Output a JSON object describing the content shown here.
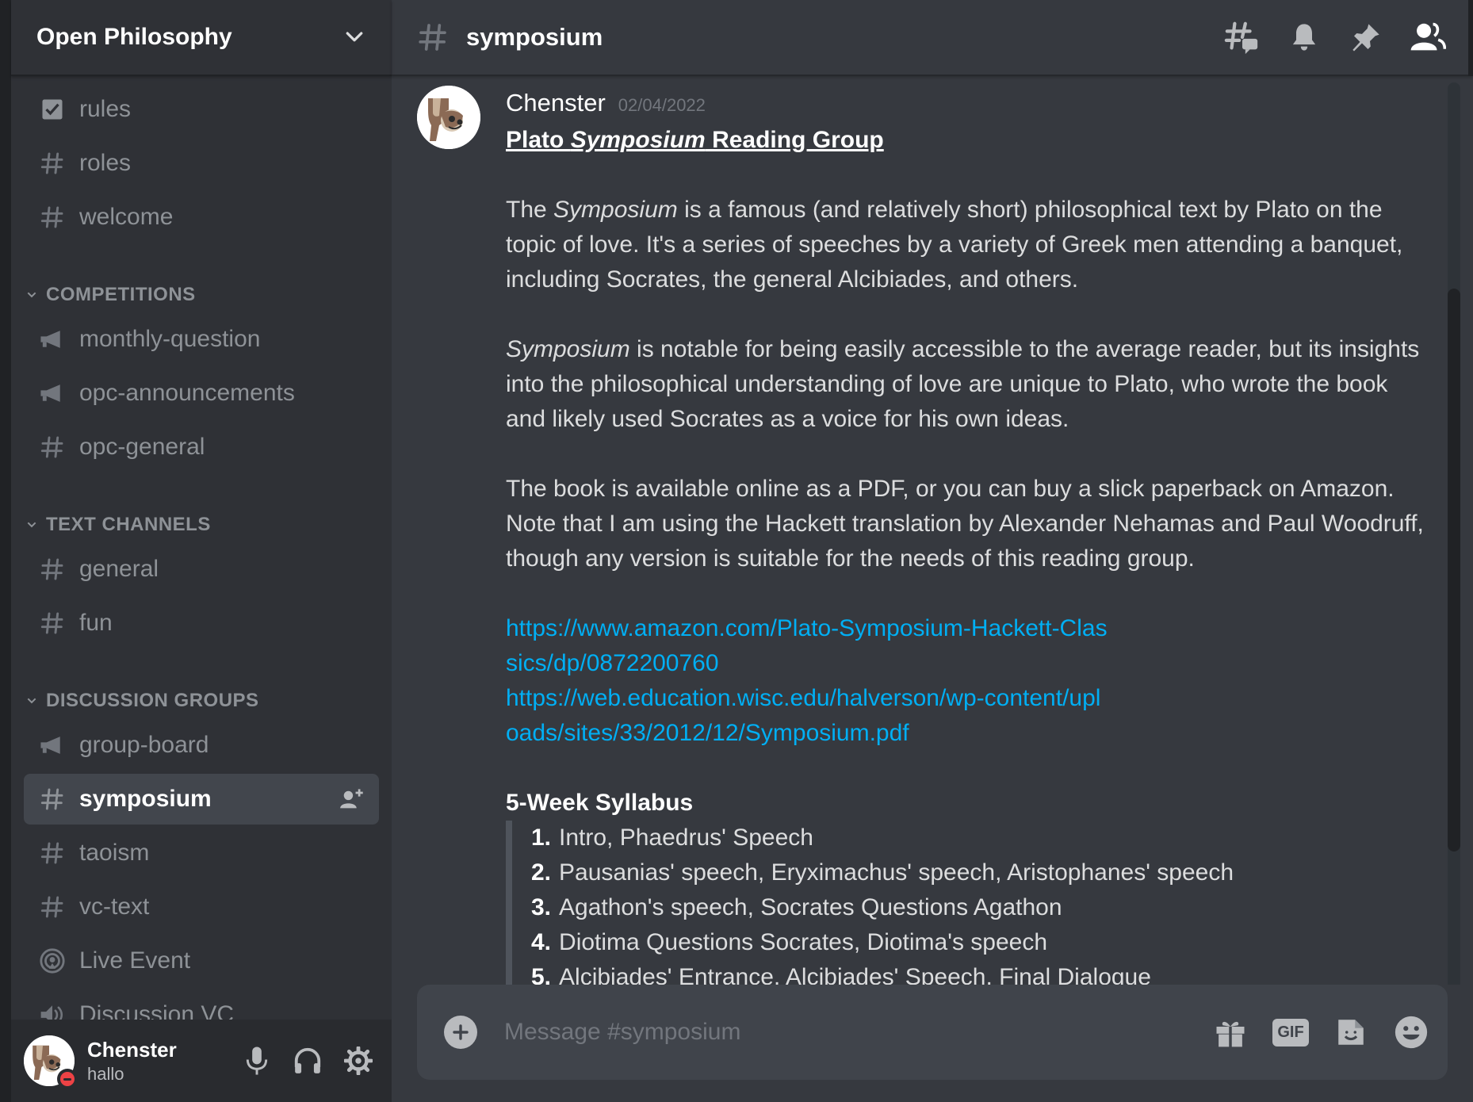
{
  "server": {
    "name": "Open Philosophy"
  },
  "channels_top": [
    {
      "name": "rules",
      "icon": "rules-checkbox-icon"
    },
    {
      "name": "roles",
      "icon": "hash-icon"
    },
    {
      "name": "welcome",
      "icon": "hash-icon"
    }
  ],
  "categories": [
    {
      "name": "COMPETITIONS",
      "channels": [
        {
          "name": "monthly-question",
          "icon": "announcement-icon"
        },
        {
          "name": "opc-announcements",
          "icon": "announcement-icon"
        },
        {
          "name": "opc-general",
          "icon": "hash-icon"
        }
      ]
    },
    {
      "name": "TEXT CHANNELS",
      "channels": [
        {
          "name": "general",
          "icon": "hash-icon"
        },
        {
          "name": "fun",
          "icon": "hash-icon"
        }
      ]
    },
    {
      "name": "DISCUSSION GROUPS",
      "channels": [
        {
          "name": "group-board",
          "icon": "announcement-icon"
        },
        {
          "name": "symposium",
          "icon": "hash-icon",
          "active": true
        },
        {
          "name": "taoism",
          "icon": "hash-icon"
        },
        {
          "name": "vc-text",
          "icon": "hash-icon"
        },
        {
          "name": "Live Event",
          "icon": "stage-icon"
        },
        {
          "name": "Discussion VC",
          "icon": "speaker-icon"
        }
      ]
    }
  ],
  "user": {
    "name": "Chenster",
    "status": "hallo",
    "presence_color": "#ed4245"
  },
  "header": {
    "channel": "symposium"
  },
  "message": {
    "author": "Chenster",
    "timestamp": "02/04/2022",
    "title_pre": "Plato ",
    "title_italic": "Symposium",
    "title_post": " Reading Group",
    "p1_pre": "The ",
    "p1_italic": "Symposium",
    "p1_post": " is a famous (and relatively short) philosophical text by Plato on the topic of love. It's a series of speeches by a variety of Greek men attending a banquet, including Socrates, the general Alcibiades, and others.",
    "p2_italic": "Symposium",
    "p2_post": " is notable for being easily accessible to the average reader, but its insights into the philosophical understanding of love are unique to Plato, who wrote the book and likely used Socrates as a voice for his own ideas.",
    "p3": "The book is available online as a PDF, or you can buy a slick paperback on Amazon. Note that I am using the Hackett translation by Alexander Nehamas and Paul Woodruff, though any version is suitable for the needs of this reading group.",
    "link1": "https://www.amazon.com/Plato-Symposium-Hackett-Classics/dp/0872200760",
    "link2": "https://web.education.wisc.edu/halverson/wp-content/uploads/sites/33/2012/12/Symposium.pdf",
    "syllabus_title": "5-Week Syllabus",
    "syllabus": [
      {
        "num": "1.",
        "text": "Intro, Phaedrus' Speech"
      },
      {
        "num": "2.",
        "text": "Pausanias' speech, Eryximachus' speech, Aristophanes' speech"
      },
      {
        "num": "3.",
        "text": "Agathon's speech, Socrates Questions Agathon"
      },
      {
        "num": "4.",
        "text": "Diotima Questions Socrates, Diotima's speech"
      },
      {
        "num": "5.",
        "text": "Alcibiades' Entrance, Alcibiades' Speech, Final Dialogue"
      }
    ]
  },
  "composer": {
    "placeholder": "Message #symposium",
    "gif_label": "GIF"
  },
  "colors": {
    "link": "#00aff4",
    "sidebar_bg": "#2f3136",
    "chat_bg": "#36393f"
  }
}
